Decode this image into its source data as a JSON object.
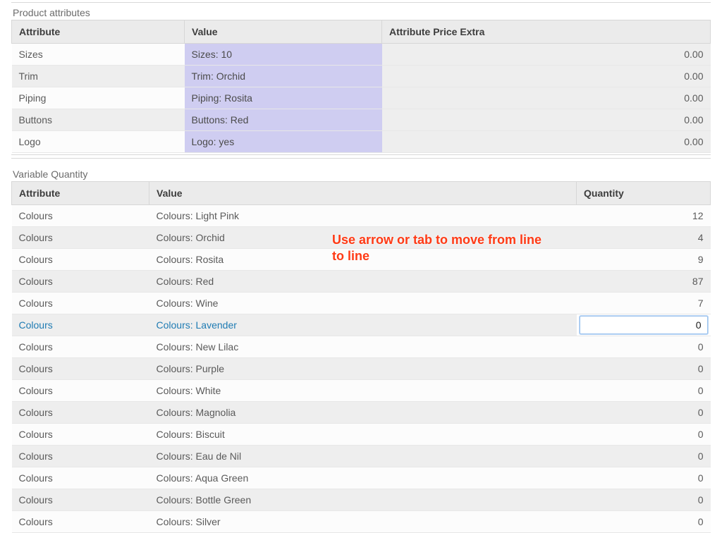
{
  "productAttributes": {
    "title": "Product attributes",
    "headers": {
      "attr": "Attribute",
      "value": "Value",
      "extra": "Attribute Price Extra"
    },
    "rows": [
      {
        "attr": "Sizes",
        "value": "Sizes: 10",
        "extra": "0.00"
      },
      {
        "attr": "Trim",
        "value": "Trim: Orchid",
        "extra": "0.00"
      },
      {
        "attr": "Piping",
        "value": "Piping: Rosita",
        "extra": "0.00"
      },
      {
        "attr": "Buttons",
        "value": "Buttons: Red",
        "extra": "0.00"
      },
      {
        "attr": "Logo",
        "value": "Logo: yes",
        "extra": "0.00"
      }
    ]
  },
  "variableQuantity": {
    "title": "Variable Quantity",
    "headers": {
      "attr": "Attribute",
      "value": "Value",
      "qty": "Quantity"
    },
    "selectedIndex": 5,
    "inputValue": "0",
    "rows": [
      {
        "attr": "Colours",
        "value": "Colours: Light Pink",
        "qty": "12"
      },
      {
        "attr": "Colours",
        "value": "Colours: Orchid",
        "qty": "4"
      },
      {
        "attr": "Colours",
        "value": "Colours: Rosita",
        "qty": "9"
      },
      {
        "attr": "Colours",
        "value": "Colours: Red",
        "qty": "87"
      },
      {
        "attr": "Colours",
        "value": "Colours: Wine",
        "qty": "7"
      },
      {
        "attr": "Colours",
        "value": "Colours: Lavender",
        "qty": "0"
      },
      {
        "attr": "Colours",
        "value": "Colours: New Lilac",
        "qty": "0"
      },
      {
        "attr": "Colours",
        "value": "Colours: Purple",
        "qty": "0"
      },
      {
        "attr": "Colours",
        "value": "Colours: White",
        "qty": "0"
      },
      {
        "attr": "Colours",
        "value": "Colours: Magnolia",
        "qty": "0"
      },
      {
        "attr": "Colours",
        "value": "Colours: Biscuit",
        "qty": "0"
      },
      {
        "attr": "Colours",
        "value": "Colours: Eau de Nil",
        "qty": "0"
      },
      {
        "attr": "Colours",
        "value": "Colours: Aqua Green",
        "qty": "0"
      },
      {
        "attr": "Colours",
        "value": "Colours: Bottle Green",
        "qty": "0"
      },
      {
        "attr": "Colours",
        "value": "Colours: Silver",
        "qty": "0"
      }
    ]
  },
  "annotation": {
    "text": "Use arrow or tab to move from line to line"
  }
}
